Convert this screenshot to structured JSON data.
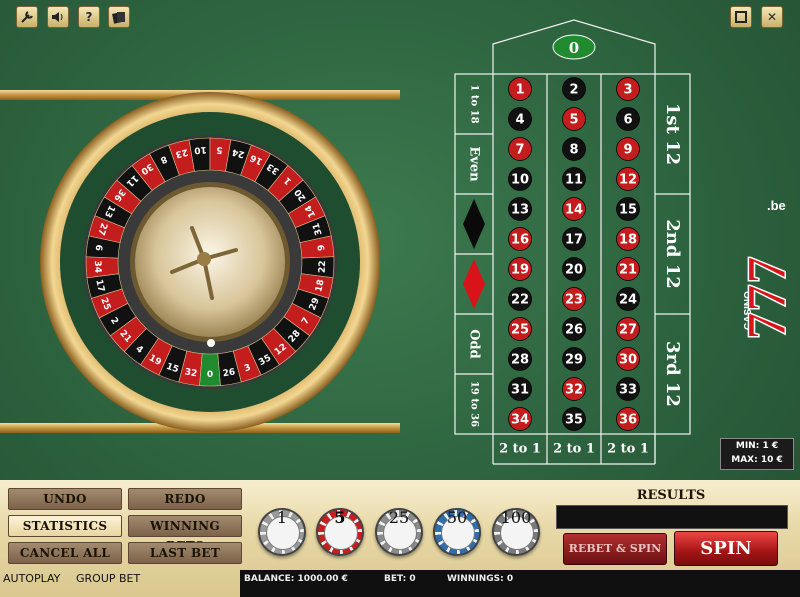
{
  "toolbar": {
    "settings_icon": "wrench-icon",
    "sound_icon": "speaker-icon",
    "help_label": "?",
    "cards_icon": "cards-icon",
    "window_icon": "window-icon",
    "close_label": "✕"
  },
  "table": {
    "zero": "0",
    "numbers": [
      [
        "1",
        "2",
        "3"
      ],
      [
        "4",
        "5",
        "6"
      ],
      [
        "7",
        "8",
        "9"
      ],
      [
        "10",
        "11",
        "12"
      ],
      [
        "13",
        "14",
        "15"
      ],
      [
        "16",
        "17",
        "18"
      ],
      [
        "19",
        "20",
        "21"
      ],
      [
        "22",
        "23",
        "24"
      ],
      [
        "25",
        "26",
        "27"
      ],
      [
        "28",
        "29",
        "30"
      ],
      [
        "31",
        "32",
        "33"
      ],
      [
        "34",
        "35",
        "36"
      ]
    ],
    "red_numbers": [
      1,
      3,
      5,
      7,
      9,
      12,
      14,
      16,
      18,
      19,
      21,
      23,
      25,
      27,
      30,
      32,
      34,
      36
    ],
    "dozens": [
      "1st 12",
      "2nd 12",
      "3rd 12"
    ],
    "outside": [
      "1 to 18",
      "Even",
      "Odd",
      "19 to 36"
    ],
    "columns": [
      "2 to 1",
      "2 to 1",
      "2 to 1"
    ]
  },
  "wheel": {
    "numbers": [
      "0",
      "32",
      "15",
      "19",
      "4",
      "21",
      "2",
      "25",
      "17",
      "34",
      "6",
      "27",
      "13",
      "36",
      "11",
      "30",
      "8",
      "23",
      "10",
      "5",
      "24",
      "16",
      "33",
      "1",
      "20",
      "14",
      "31",
      "9",
      "22",
      "18",
      "29",
      "7",
      "28",
      "12",
      "35",
      "3",
      "26"
    ]
  },
  "logo": {
    "casino": "CASINO",
    "digits": "777",
    "domain": ".be"
  },
  "limits": {
    "min": "MIN: 1 €",
    "max": "MAX: 10 €"
  },
  "controls": {
    "undo": "UNDO",
    "redo": "REDO",
    "statistics": "STATISTICS",
    "winning_bets": "WINNING BETS",
    "cancel_all": "CANCEL ALL",
    "last_bet": "LAST BET"
  },
  "chips": [
    {
      "value": "1",
      "color": "#9a9a9a"
    },
    {
      "value": "5",
      "color": "#c81e1e"
    },
    {
      "value": "25",
      "color": "#8a8a8a"
    },
    {
      "value": "50",
      "color": "#2f6fb0"
    },
    {
      "value": "100",
      "color": "#7a7a7a"
    }
  ],
  "results": {
    "label": "RESULTS"
  },
  "buttons": {
    "rebet_spin": "REBET & SPIN",
    "spin": "SPIN"
  },
  "status": {
    "autoplay": "AUTOPLAY",
    "group_bet": "GROUP BET",
    "balance": "BALANCE: 1000.00 €",
    "bet": "BET: 0",
    "winnings": "WINNINGS: 0"
  },
  "colors": {
    "red": "#c41d1d",
    "black": "#111111",
    "felt": "#2f6641",
    "gold": "#c9a24a"
  }
}
